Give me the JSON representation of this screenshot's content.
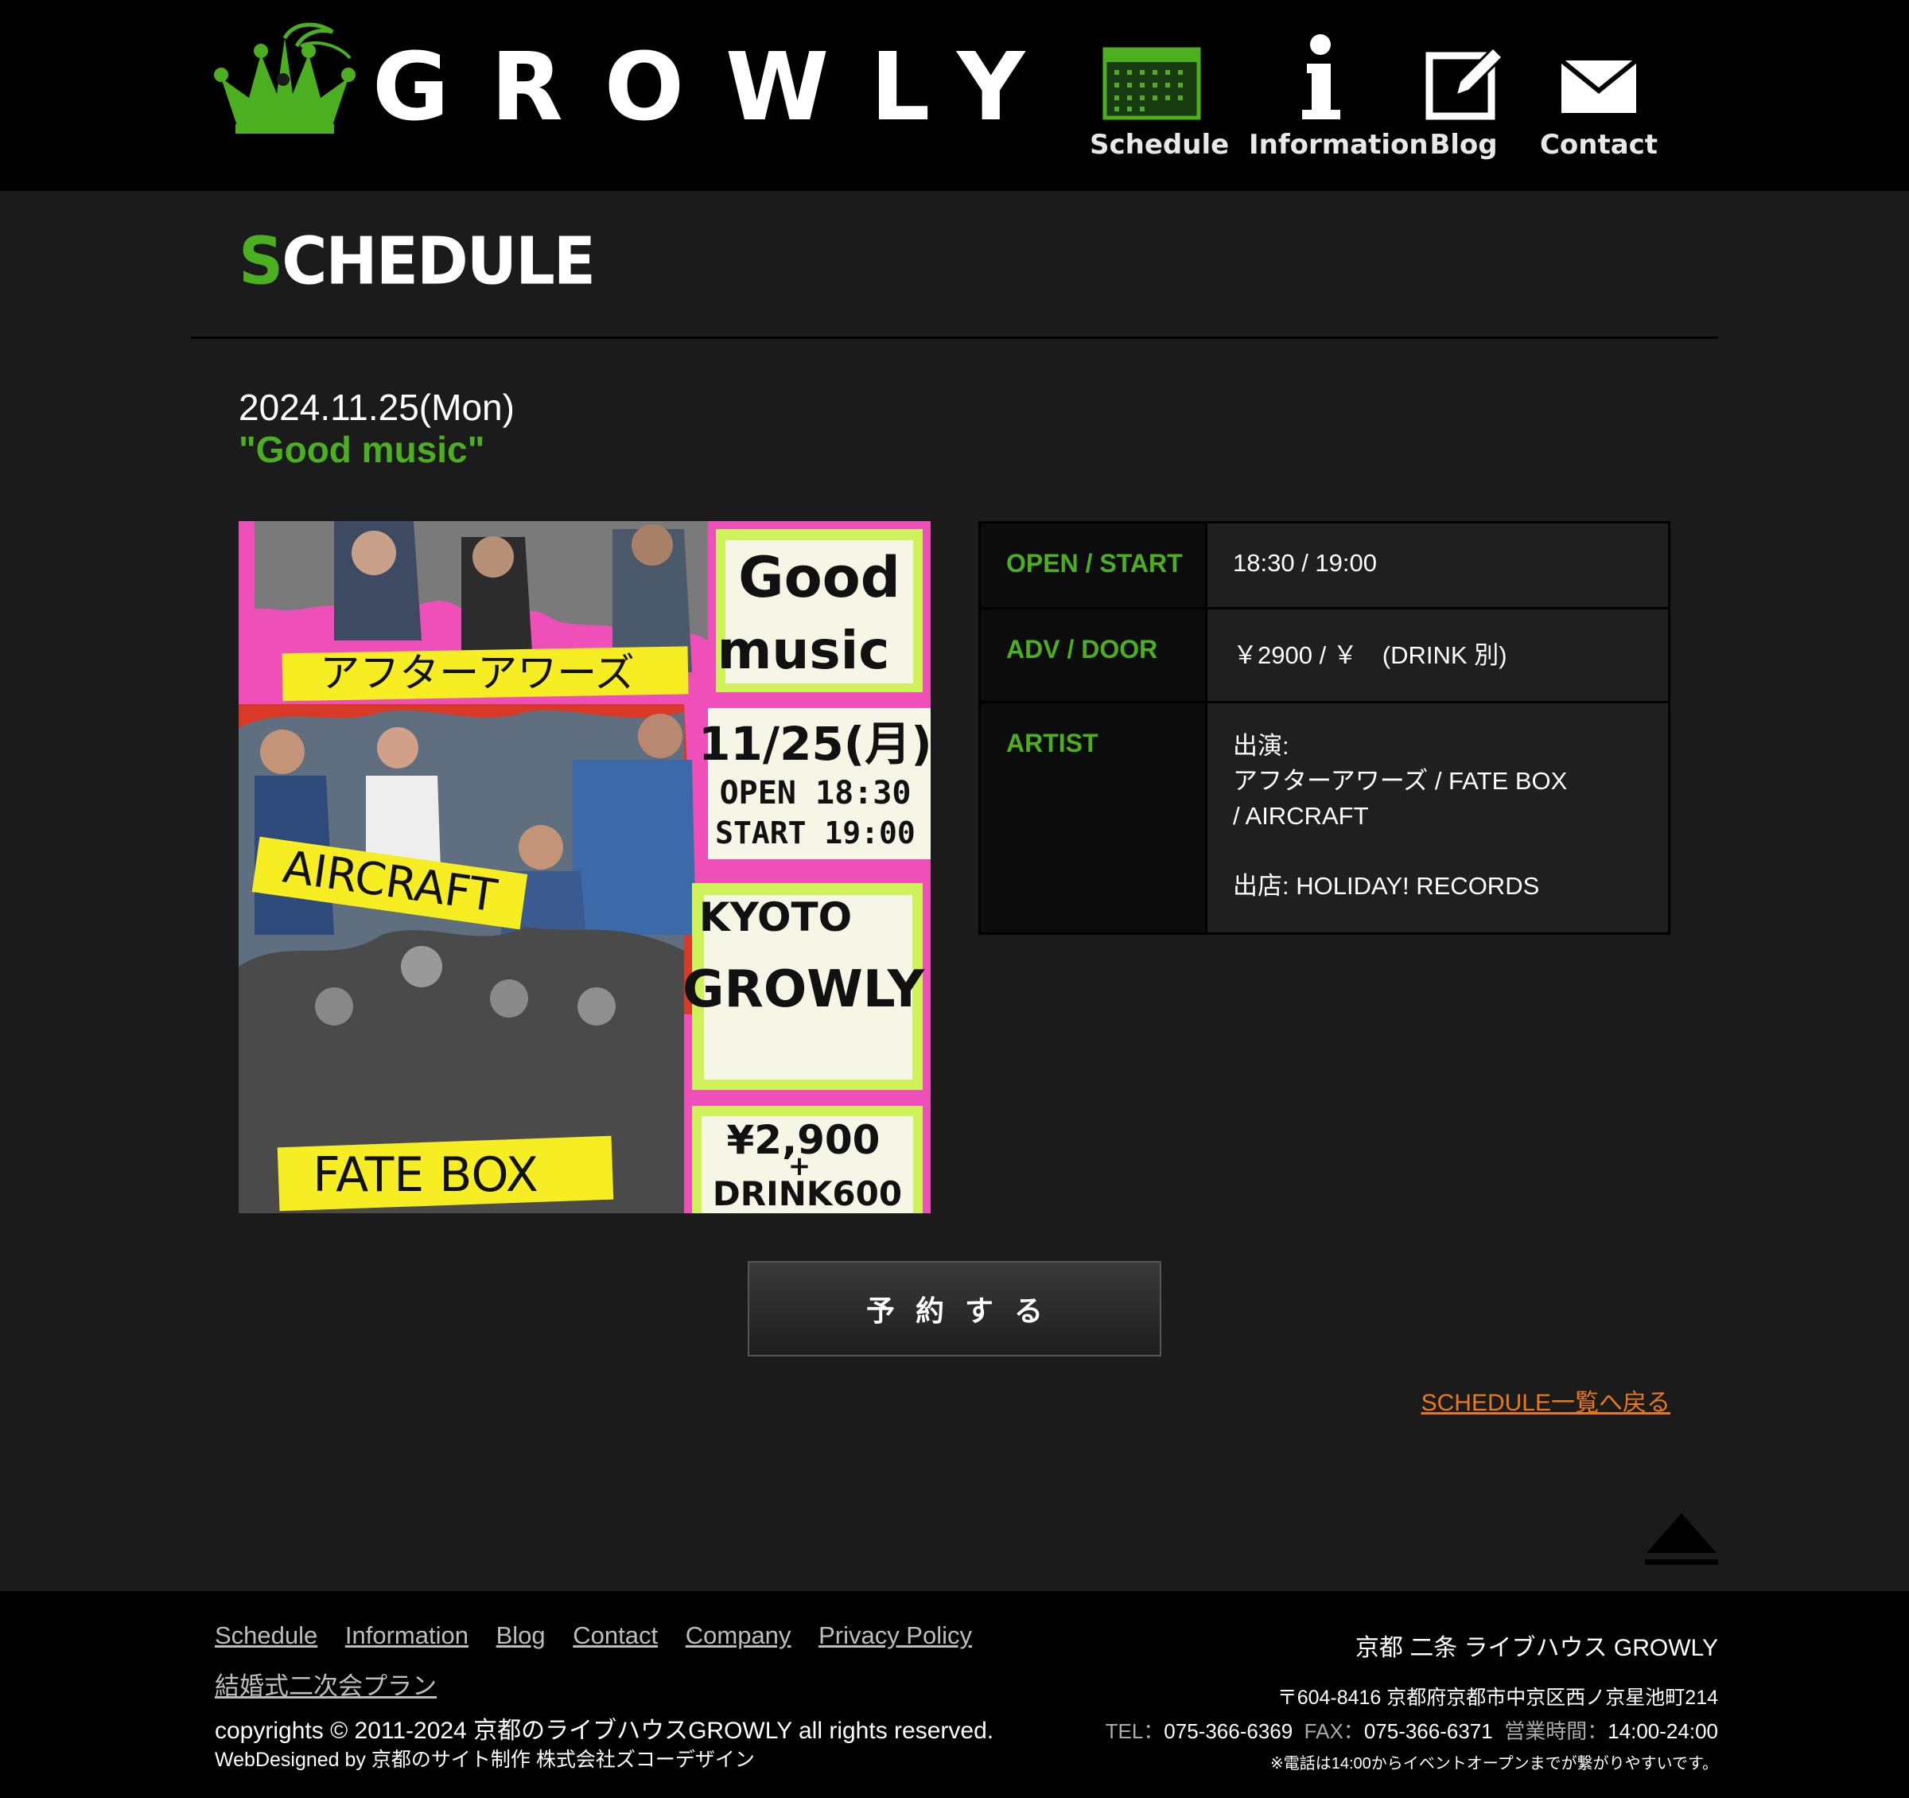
{
  "header": {
    "logo_text": "GROWLY",
    "nav": [
      {
        "label": "Schedule",
        "icon": "calendar-icon"
      },
      {
        "label": "Information",
        "icon": "info-icon"
      },
      {
        "label": "Blog",
        "icon": "edit-icon"
      },
      {
        "label": "Contact",
        "icon": "mail-icon"
      }
    ]
  },
  "page": {
    "section_title_first": "S",
    "section_title_rest": "CHEDULE"
  },
  "event": {
    "date": "2024.11.25(Mon)",
    "title": "\"Good music\"",
    "flyer": {
      "good": "Good",
      "music": "music",
      "date": "11/25(月)",
      "open": "OPEN 18:30",
      "start": "START 19:00",
      "kyoto": "KYOTO",
      "growly": "GROWLY",
      "price": "¥2,900",
      "plus": "+",
      "drink": "DRINK600",
      "band1": "アフターアワーズ",
      "band2": "AIRCRAFT",
      "band3": "FATE BOX"
    },
    "info": {
      "open_start_label": "OPEN / START",
      "open_start_value": "18:30 / 19:00",
      "adv_door_label": "ADV / DOOR",
      "adv_door_value": "￥2900 / ￥　(DRINK 別)",
      "artist_label": "ARTIST",
      "artist_lines": [
        "出演:",
        "アフターアワーズ / FATE BOX",
        "/ AIRCRAFT",
        "",
        "出店: HOLIDAY! RECORDS"
      ]
    },
    "reserve_label": "予約する",
    "back_link": "SCHEDULE一覧へ戻る"
  },
  "footer": {
    "nav": [
      "Schedule",
      "Information",
      "Blog",
      "Contact",
      "Company",
      "Privacy Policy"
    ],
    "nav2": "結婚式二次会プラン",
    "copyright": "copyrights © 2011-2024 京都のライブハウスGROWLY all rights reserved.",
    "webdesign": "WebDesigned by 京都のサイト制作 株式会社ズコーデザイン",
    "venue": "京都 二条 ライブハウス GROWLY",
    "address": "〒604-8416 京都府京都市中京区西ノ京星池町214",
    "tel_label": "TEL：",
    "tel": "075-366-6369",
    "fax_label": "FAX：",
    "fax": "075-366-6371",
    "hours_label": "営業時間：",
    "hours": "14:00-24:00",
    "note": "※電話は14:00からイベントオープンまでが繋がりやすいです。"
  },
  "colors": {
    "accent_green": "#4caf1f",
    "link_orange": "#e97a15",
    "flyer_pink": "#ef4fb8"
  }
}
